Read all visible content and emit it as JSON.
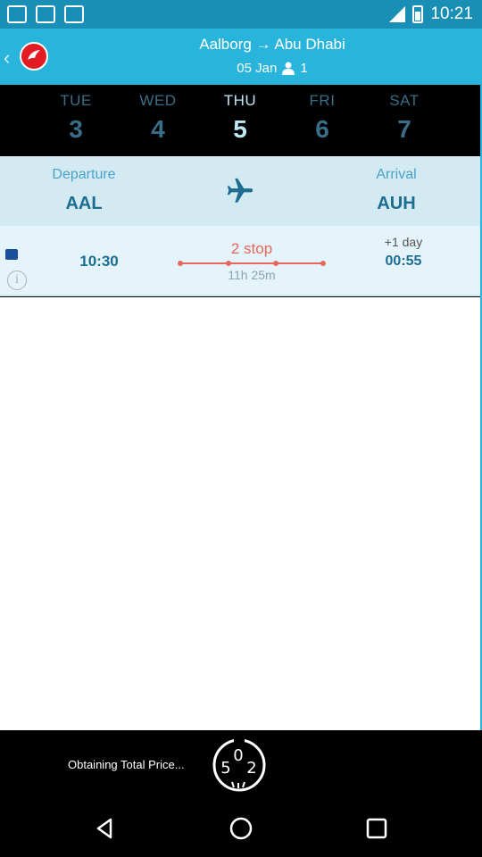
{
  "status_bar": {
    "time": "10:21",
    "left_icons": [
      "notification-icon",
      "notification-icon",
      "notification-icon"
    ],
    "right_icons": [
      "signal-icon",
      "battery-icon"
    ]
  },
  "header": {
    "back_icon": "chevron-left-icon",
    "logo_icon": "turkish-airlines-logo-icon",
    "origin": "Aalborg",
    "arrow": "→",
    "destination": "Abu Dhabi",
    "date": "05 Jan",
    "passenger_icon": "person-icon",
    "passengers": "1"
  },
  "days": [
    {
      "name": "TUE",
      "num": "3",
      "active": false
    },
    {
      "name": "WED",
      "num": "4",
      "active": false
    },
    {
      "name": "THU",
      "num": "5",
      "active": true
    },
    {
      "name": "FRI",
      "num": "6",
      "active": false
    },
    {
      "name": "SAT",
      "num": "7",
      "active": false
    }
  ],
  "summary": {
    "departure_label": "Departure",
    "departure_code": "AAL",
    "plane_icon": "airplane-icon",
    "arrival_label": "Arrival",
    "arrival_code": "AUH"
  },
  "flight": {
    "airline_icon": "sas-airline-icon",
    "info_icon": "info-icon",
    "departure_time": "10:30",
    "stops": "2 stop",
    "duration": "11h 25m",
    "day_offset": "+1 day",
    "arrival_time": "00:55"
  },
  "loading": {
    "text": "Obtaining Total Price...",
    "spinner_icon": "loading-spinner-icon",
    "spinner_digits": [
      "0",
      "5",
      "2"
    ]
  },
  "nav": {
    "back_icon": "back-triangle-icon",
    "home_icon": "home-circle-icon",
    "recents_icon": "recents-square-icon"
  },
  "colors": {
    "header_bg": "#29b4dc",
    "status_bg": "#1a8fb5",
    "summary_bg": "#d4eaf2",
    "row_bg": "#e4f4fa",
    "accent_dark": "#1c6d90",
    "stop_red": "#e8665a",
    "logo_red": "#e31c23"
  }
}
